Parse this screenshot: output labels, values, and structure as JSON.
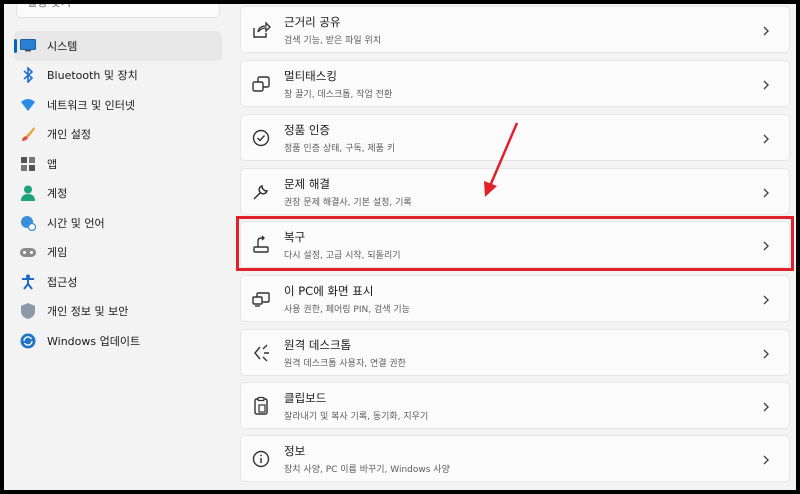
{
  "sidebar": {
    "search_placeholder": "설정 찾기",
    "items": [
      {
        "label": "시스템",
        "icon": "monitor-icon",
        "active": true
      },
      {
        "label": "Bluetooth 및 장치",
        "icon": "bluetooth-icon"
      },
      {
        "label": "네트워크 및 인터넷",
        "icon": "wifi-icon"
      },
      {
        "label": "개인 설정",
        "icon": "brush-icon"
      },
      {
        "label": "앱",
        "icon": "apps-icon"
      },
      {
        "label": "계정",
        "icon": "person-icon"
      },
      {
        "label": "시간 및 언어",
        "icon": "globe-clock-icon"
      },
      {
        "label": "게임",
        "icon": "gamepad-icon"
      },
      {
        "label": "접근성",
        "icon": "accessibility-icon"
      },
      {
        "label": "개인 정보 및 보안",
        "icon": "shield-icon"
      },
      {
        "label": "Windows 업데이트",
        "icon": "update-icon"
      }
    ]
  },
  "settings": [
    {
      "title": "근거리 공유",
      "subtitle": "검색 기능, 받은 파일 위치",
      "icon": "share-icon"
    },
    {
      "title": "멀티태스킹",
      "subtitle": "창 끌기, 데스크톱, 작업 전환",
      "icon": "multitask-icon"
    },
    {
      "title": "정품 인증",
      "subtitle": "정품 인증 상태, 구독, 제품 키",
      "icon": "activation-icon"
    },
    {
      "title": "문제 해결",
      "subtitle": "권장 문제 해결사, 기본 설정, 기록",
      "icon": "wrench-icon"
    },
    {
      "title": "복구",
      "subtitle": "다시 설정, 고급 시작, 되돌리기",
      "icon": "recovery-icon"
    },
    {
      "title": "이 PC에 화면 표시",
      "subtitle": "사용 권한, 페어링 PIN, 검색 기능",
      "icon": "project-icon"
    },
    {
      "title": "원격 데스크톱",
      "subtitle": "원격 데스크톱 사용자, 연결 권한",
      "icon": "remote-desktop-icon"
    },
    {
      "title": "클립보드",
      "subtitle": "잘라내기 및 복사 기록, 동기화, 지우기",
      "icon": "clipboard-icon"
    },
    {
      "title": "정보",
      "subtitle": "장치 사양, PC 이름 바꾸기, Windows 사양",
      "icon": "info-icon"
    }
  ],
  "colors": {
    "accent": "#0067c0",
    "annotation": "#e0202a"
  }
}
